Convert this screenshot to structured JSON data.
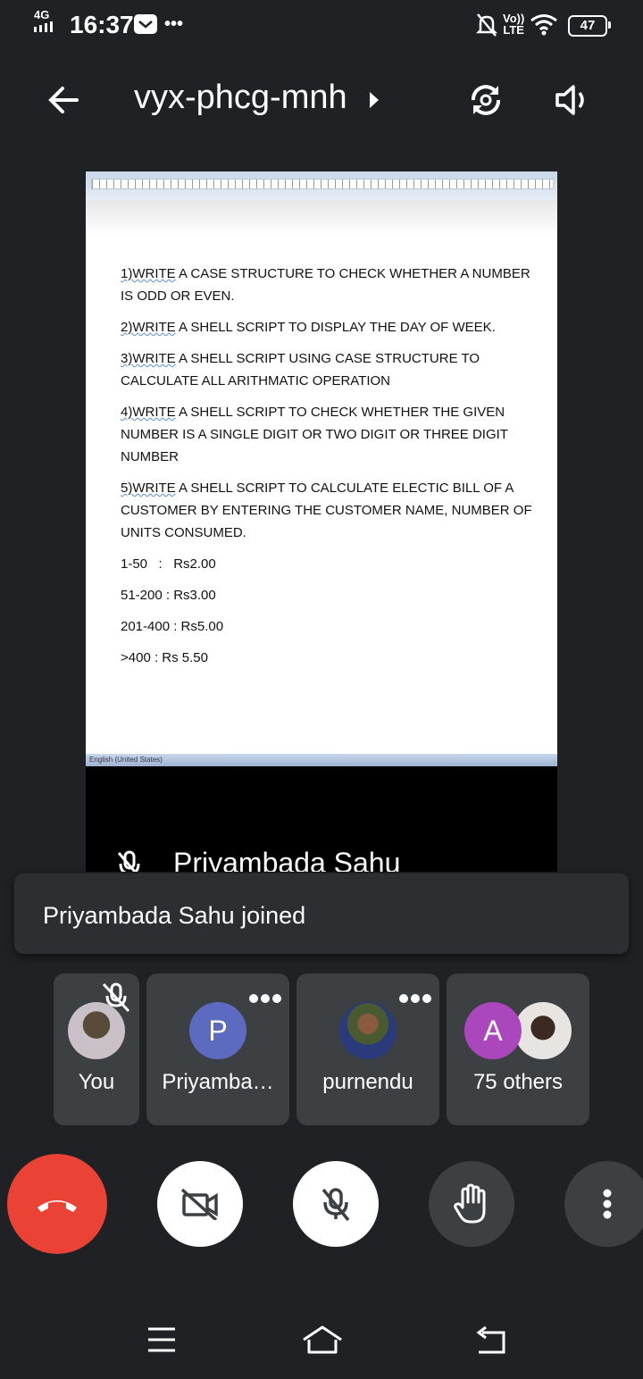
{
  "status_bar": {
    "network": "4G",
    "time": "16:37",
    "more": "•••",
    "volte_top": "Vo))",
    "volte_bottom": "LTE",
    "battery": "47"
  },
  "header": {
    "meeting_code": "vyx-phcg-mnh"
  },
  "shared_screen": {
    "questions": [
      {
        "num": "1)WRITE",
        "text": " A CASE STRUCTURE TO CHECK WHETHER A NUMBER IS ODD OR EVEN."
      },
      {
        "num": "2)WRITE",
        "text": " A SHELL SCRIPT TO DISPLAY THE DAY OF WEEK."
      },
      {
        "num": "3)WRITE",
        "text": " A SHELL SCRIPT USING CASE STRUCTURE TO CALCULATE ALL ARITHMATIC OPERATION"
      },
      {
        "num": "4)WRITE",
        "text": " A SHELL SCRIPT TO CHECK WHETHER THE GIVEN NUMBER IS A SINGLE DIGIT OR TWO DIGIT OR THREE DIGIT NUMBER"
      },
      {
        "num": "5)WRITE",
        "text": " A SHELL SCRIPT TO CALCULATE ELECTIC BILL OF A CUSTOMER BY ENTERING THE CUSTOMER NAME, NUMBER OF UNITS CONSUMED."
      }
    ],
    "rates": [
      "1-50   :   Rs2.00",
      "51-200 : Rs3.00",
      "201-400 : Rs5.00",
      ">400 : Rs 5.50"
    ],
    "doc_status": "English (United States)",
    "presenter_name": "Priyambada Sahu"
  },
  "toast": {
    "message": "Priyambada Sahu joined"
  },
  "participants": [
    {
      "label": "You"
    },
    {
      "label": "Priyamba…",
      "initial": "P",
      "color": "#5c6bc0"
    },
    {
      "label": "purnendu"
    },
    {
      "label": "75 others",
      "initial": "A",
      "color": "#ab47bc"
    }
  ]
}
